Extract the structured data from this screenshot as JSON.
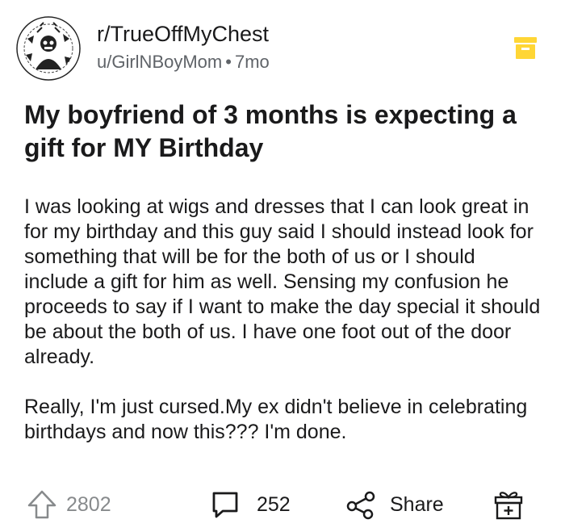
{
  "post": {
    "subreddit": "r/TrueOffMyChest",
    "author": "u/GirlNBoyMom",
    "separator": "•",
    "age": "7mo",
    "title": "My boyfriend of 3 months is expecting a gift for MY Birthday",
    "body": [
      "I was looking at wigs and dresses that I can look great in for my birthday and this guy said I should instead look for something that will be for the both of us or I should include a gift for him as well. Sensing my confusion he proceeds to say if I want to make the day special it should be about the both of us. I have one foot out of the door already.",
      "Really, I'm just cursed.My ex didn't believe in celebrating birthdays and now this??? I'm done."
    ]
  },
  "actions": {
    "upvotes": "2802",
    "comments": "252",
    "share_label": "Share"
  },
  "icons": {
    "avatar": "subreddit-avatar",
    "archive": "archive-box-icon",
    "upvote": "upvote-arrow-icon",
    "comment": "comment-bubble-icon",
    "share": "share-icon",
    "award": "gift-award-icon"
  },
  "colors": {
    "accent_yellow": "#FFD635",
    "text": "#1A1A1B",
    "muted": "#878A8C"
  }
}
